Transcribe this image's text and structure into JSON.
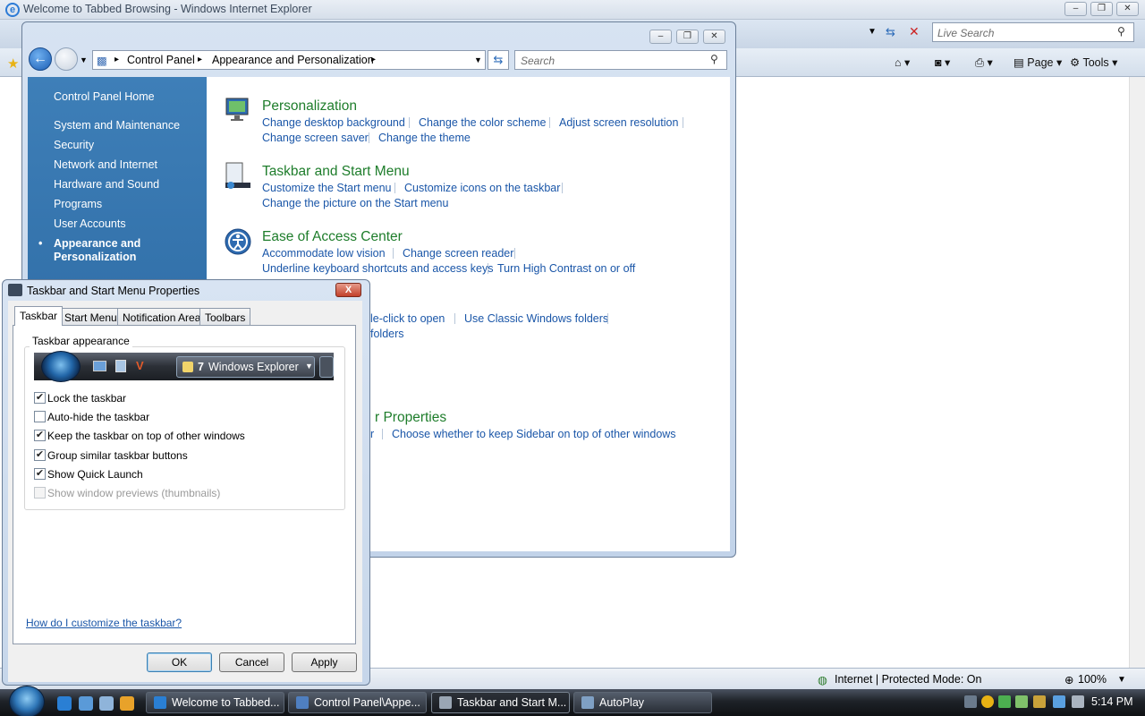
{
  "ie": {
    "window_title": "Welcome to Tabbed Browsing - Windows Internet Explorer",
    "search_placeholder": "Live Search",
    "toolbar": {
      "page_label": "Page",
      "tools_label": "Tools"
    },
    "status": {
      "zone": "Internet | Protected Mode: On",
      "zoom": "100%"
    }
  },
  "control_panel": {
    "breadcrumb": [
      "Control Panel",
      "Appearance and Personalization"
    ],
    "search_placeholder": "Search",
    "sidebar": {
      "home": "Control Panel Home",
      "items": [
        "System and Maintenance",
        "Security",
        "Network and Internet",
        "Hardware and Sound",
        "Programs",
        "User Accounts"
      ],
      "current_line1": "Appearance and",
      "current_line2": "Personalization"
    },
    "categories": [
      {
        "title": "Personalization",
        "links": [
          "Change desktop background",
          "Change the color scheme",
          "Adjust screen resolution",
          "Change screen saver",
          "Change the theme"
        ]
      },
      {
        "title": "Taskbar and Start Menu",
        "links": [
          "Customize the Start menu",
          "Customize icons on the taskbar",
          "Change the picture on the Start menu"
        ]
      },
      {
        "title": "Ease of Access Center",
        "links": [
          "Accommodate low vision",
          "Change screen reader",
          "Underline keyboard shortcuts and access keys",
          "Turn High Contrast on or off"
        ]
      },
      {
        "title_fragment": "le-click to open",
        "links": [
          "Use Classic Windows folders",
          "folders"
        ]
      },
      {
        "title_fragment": "r Properties",
        "links": [
          "r",
          "Choose whether to keep Sidebar on top of other windows"
        ]
      }
    ]
  },
  "dialog": {
    "title": "Taskbar and Start Menu Properties",
    "close_label": "X",
    "tabs": [
      "Taskbar",
      "Start Menu",
      "Notification Area",
      "Toolbars"
    ],
    "group_label": "Taskbar appearance",
    "preview_button": "Windows Explorer",
    "preview_count": "7",
    "options": [
      {
        "label": "Lock the taskbar",
        "checked": true,
        "enabled": true
      },
      {
        "label": "Auto-hide the taskbar",
        "checked": false,
        "enabled": true
      },
      {
        "label": "Keep the taskbar on top of other windows",
        "checked": true,
        "enabled": true
      },
      {
        "label": "Group similar taskbar buttons",
        "checked": true,
        "enabled": true
      },
      {
        "label": "Show Quick Launch",
        "checked": true,
        "enabled": true
      },
      {
        "label": "Show window previews (thumbnails)",
        "checked": false,
        "enabled": false
      }
    ],
    "help_link": "How do I customize the taskbar?",
    "buttons": {
      "ok": "OK",
      "cancel": "Cancel",
      "apply": "Apply"
    }
  },
  "taskbar": {
    "buttons": [
      {
        "label": "Welcome to Tabbed...",
        "active": false
      },
      {
        "label": "Control Panel\\Appe...",
        "active": false
      },
      {
        "label": "Taskbar and Start M...",
        "active": true
      },
      {
        "label": "AutoPlay",
        "active": false
      }
    ],
    "time": "5:14 PM"
  },
  "colors": {
    "link": "#1a56a8",
    "category_title": "#1e7d2b",
    "sidebar_bg": "#2f6da6",
    "taskbar_bg": "#1e2228"
  }
}
